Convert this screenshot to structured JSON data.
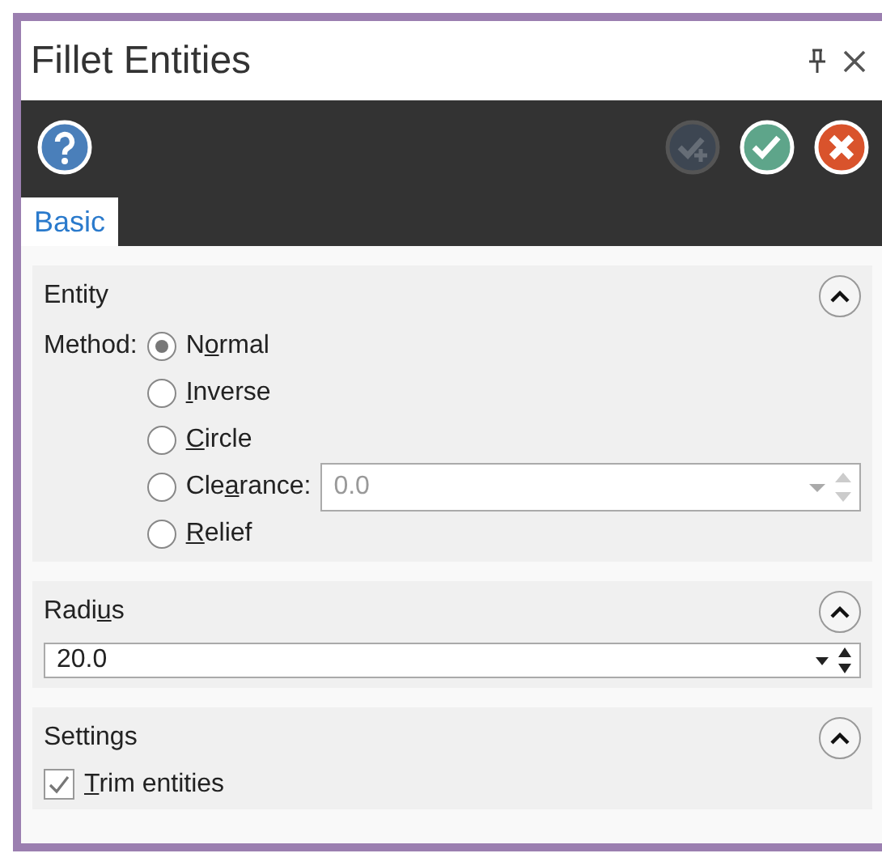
{
  "window": {
    "title": "Fillet Entities"
  },
  "toolbar": {
    "buttons": [
      {
        "kind": "help",
        "disabled": false
      },
      {
        "kind": "apply",
        "disabled": true
      },
      {
        "kind": "ok",
        "disabled": false
      },
      {
        "kind": "cancel",
        "disabled": false
      }
    ]
  },
  "tabs": [
    {
      "label": "Basic",
      "selected": true
    }
  ],
  "sections": [
    {
      "kind": "entity",
      "title": {
        "before": "Entity"
      },
      "expanded": true,
      "method_label": "Method:",
      "options": [
        {
          "before": "N",
          "key": "o",
          "after": "rmal",
          "selected": true
        },
        {
          "key": "I",
          "after": "nverse",
          "selected": false
        },
        {
          "key": "C",
          "after": "ircle",
          "selected": false
        },
        {
          "before": "Cle",
          "key": "a",
          "after": "rance:",
          "selected": false,
          "field": {
            "value": "0.0",
            "disabled": true
          }
        },
        {
          "key": "R",
          "after": "elief",
          "selected": false
        }
      ]
    },
    {
      "kind": "radius",
      "title": {
        "before": "Radi",
        "key": "u",
        "after": "s"
      },
      "expanded": true,
      "field": {
        "value": "20.0",
        "disabled": false
      }
    },
    {
      "kind": "settings",
      "title": {
        "before": "Settings"
      },
      "expanded": true,
      "checkboxes": [
        {
          "key": "T",
          "after": "rim entities",
          "checked": true
        }
      ]
    }
  ]
}
